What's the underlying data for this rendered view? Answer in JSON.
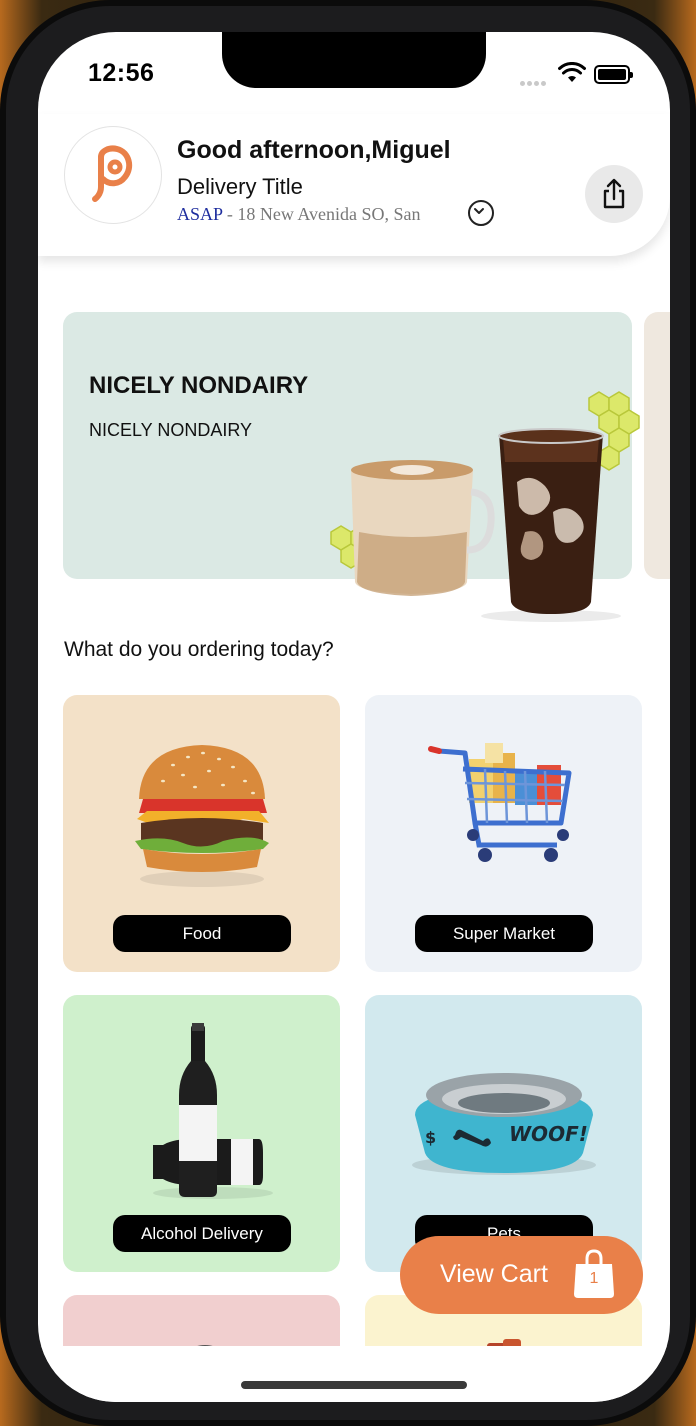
{
  "status_bar": {
    "time": "12:56"
  },
  "header": {
    "greeting": "Good afternoon,Miguel",
    "delivery_title": "Delivery Title",
    "asap": "ASAP",
    "address": " - 18 New Avenida SO, San",
    "brand_color": "#e98049"
  },
  "banner": {
    "title": "NICELY NONDAIRY",
    "subtitle": "NICELY NONDAIRY"
  },
  "section_title": "What do you ordering today?",
  "categories": [
    {
      "label": "Food",
      "bg": "#f3e1c8"
    },
    {
      "label": "Super Market",
      "bg": "#eef2f7"
    },
    {
      "label": "Alcohol Delivery",
      "bg": "#cff0cc"
    },
    {
      "label": "Pets",
      "bg": "#d2e9ee"
    }
  ],
  "cart": {
    "label": "View Cart",
    "count": "1"
  },
  "icons": {
    "share": "share-icon",
    "chevron": "chevron-down-icon",
    "bag": "shopping-bag-icon"
  }
}
